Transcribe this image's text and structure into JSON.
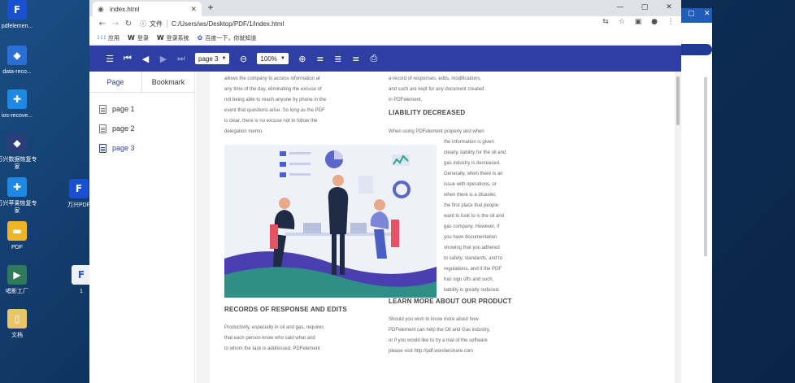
{
  "desktop": {
    "icons": [
      {
        "label": "pdfelemen...",
        "glyph": "F",
        "color": "#1a4fd0"
      },
      {
        "label": "data-reco...",
        "glyph": "◆",
        "color": "#2b6fd6"
      },
      {
        "label": "ios-recove...",
        "glyph": "✚",
        "color": "#1e88e5"
      },
      {
        "label": "万兴数据恢复专家",
        "glyph": "◆",
        "color": "#2a3f7a"
      },
      {
        "label": "万兴苹果恢复专家",
        "glyph": "✚",
        "color": "#1e88e5"
      },
      {
        "label": "PDF",
        "glyph": "▬",
        "color": "#f0b429"
      },
      {
        "label": "唱影工厂",
        "glyph": "▶",
        "color": "#2f7a5a"
      },
      {
        "label": "文档",
        "glyph": "▯",
        "color": "#e8c46a"
      },
      {
        "label": "万兴PDF",
        "glyph": "F",
        "color": "#1a4fd0"
      },
      {
        "label": "1",
        "glyph": "F",
        "color": "#eef1f7"
      }
    ]
  },
  "browser": {
    "tab_title": "index.html",
    "address_prefix": "文件",
    "address": "C:/Users/ws/Desktop/PDF/1/index.html",
    "bookmarks": [
      {
        "icon": "grid-icon",
        "label": "应用"
      },
      {
        "icon": "w-icon",
        "label": "登录"
      },
      {
        "icon": "w-icon",
        "label": "登录系统"
      },
      {
        "icon": "paw-icon",
        "label": "百度一下，你就知道"
      }
    ]
  },
  "viewer": {
    "page_select": "page 3",
    "zoom_select": "100%",
    "sidebar_tabs": [
      "Page",
      "Bookmark"
    ],
    "pages": [
      "page 1",
      "page 2",
      "page 3"
    ],
    "active_page": 2,
    "accent_color": "#2e3fa3"
  },
  "document": {
    "left_col_text": [
      "allows the company to access information at",
      "any time of the day, eliminating the excuse of",
      "not being able to reach anyone by phone in the",
      "event that questions arise. So long as the PDF",
      "is clear, there is no excuse not to follow the",
      "delegation memo."
    ],
    "right_col_top": [
      "a record of responses, edits, modifications,",
      "and such are kept for any document created",
      "in PDFelement."
    ],
    "heading_liability": "LIABILITY DECREASED",
    "liability_intro": "When using PDFelement properly and when",
    "liability_text": [
      "the information is given",
      "clearly, liability for the oil and",
      "gas industry is decreased.",
      "Generally, when there is an",
      "issue with operations, or",
      "when there is a disaster,",
      "the first place that people",
      "want to look to is the oil and",
      "gas company. However, if",
      "you have documentation",
      "showing that you adhered",
      "to safety, standards, and to",
      "regulations, and if the PDF",
      "has sign offs and such,",
      "liability is greatly reduced."
    ],
    "heading_records": "RECORDS OF RESPONSE AND EDITS",
    "records_text": [
      "Productivity, especially in oil and gas, requires",
      "that each person know who said what and",
      "to whom the task is addressed. PDFelement"
    ],
    "heading_learn": "LEARN MORE ABOUT OUR PRODUCT",
    "learn_text": [
      "Should you wish to know more about how",
      "PDFelement can help the Oil and Gas industry,",
      "or if you would like to try a trial of the software",
      "please visit http://pdf.wondershare.com"
    ]
  }
}
